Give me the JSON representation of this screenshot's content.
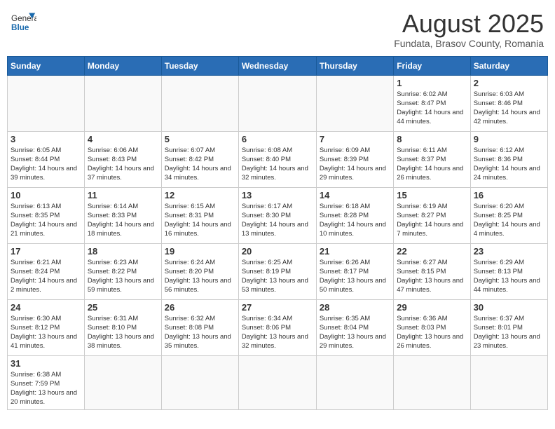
{
  "header": {
    "logo_general": "General",
    "logo_blue": "Blue",
    "month_title": "August 2025",
    "subtitle": "Fundata, Brasov County, Romania"
  },
  "weekdays": [
    "Sunday",
    "Monday",
    "Tuesday",
    "Wednesday",
    "Thursday",
    "Friday",
    "Saturday"
  ],
  "weeks": [
    [
      {
        "day": "",
        "info": ""
      },
      {
        "day": "",
        "info": ""
      },
      {
        "day": "",
        "info": ""
      },
      {
        "day": "",
        "info": ""
      },
      {
        "day": "",
        "info": ""
      },
      {
        "day": "1",
        "info": "Sunrise: 6:02 AM\nSunset: 8:47 PM\nDaylight: 14 hours and 44 minutes."
      },
      {
        "day": "2",
        "info": "Sunrise: 6:03 AM\nSunset: 8:46 PM\nDaylight: 14 hours and 42 minutes."
      }
    ],
    [
      {
        "day": "3",
        "info": "Sunrise: 6:05 AM\nSunset: 8:44 PM\nDaylight: 14 hours and 39 minutes."
      },
      {
        "day": "4",
        "info": "Sunrise: 6:06 AM\nSunset: 8:43 PM\nDaylight: 14 hours and 37 minutes."
      },
      {
        "day": "5",
        "info": "Sunrise: 6:07 AM\nSunset: 8:42 PM\nDaylight: 14 hours and 34 minutes."
      },
      {
        "day": "6",
        "info": "Sunrise: 6:08 AM\nSunset: 8:40 PM\nDaylight: 14 hours and 32 minutes."
      },
      {
        "day": "7",
        "info": "Sunrise: 6:09 AM\nSunset: 8:39 PM\nDaylight: 14 hours and 29 minutes."
      },
      {
        "day": "8",
        "info": "Sunrise: 6:11 AM\nSunset: 8:37 PM\nDaylight: 14 hours and 26 minutes."
      },
      {
        "day": "9",
        "info": "Sunrise: 6:12 AM\nSunset: 8:36 PM\nDaylight: 14 hours and 24 minutes."
      }
    ],
    [
      {
        "day": "10",
        "info": "Sunrise: 6:13 AM\nSunset: 8:35 PM\nDaylight: 14 hours and 21 minutes."
      },
      {
        "day": "11",
        "info": "Sunrise: 6:14 AM\nSunset: 8:33 PM\nDaylight: 14 hours and 18 minutes."
      },
      {
        "day": "12",
        "info": "Sunrise: 6:15 AM\nSunset: 8:31 PM\nDaylight: 14 hours and 16 minutes."
      },
      {
        "day": "13",
        "info": "Sunrise: 6:17 AM\nSunset: 8:30 PM\nDaylight: 14 hours and 13 minutes."
      },
      {
        "day": "14",
        "info": "Sunrise: 6:18 AM\nSunset: 8:28 PM\nDaylight: 14 hours and 10 minutes."
      },
      {
        "day": "15",
        "info": "Sunrise: 6:19 AM\nSunset: 8:27 PM\nDaylight: 14 hours and 7 minutes."
      },
      {
        "day": "16",
        "info": "Sunrise: 6:20 AM\nSunset: 8:25 PM\nDaylight: 14 hours and 4 minutes."
      }
    ],
    [
      {
        "day": "17",
        "info": "Sunrise: 6:21 AM\nSunset: 8:24 PM\nDaylight: 14 hours and 2 minutes."
      },
      {
        "day": "18",
        "info": "Sunrise: 6:23 AM\nSunset: 8:22 PM\nDaylight: 13 hours and 59 minutes."
      },
      {
        "day": "19",
        "info": "Sunrise: 6:24 AM\nSunset: 8:20 PM\nDaylight: 13 hours and 56 minutes."
      },
      {
        "day": "20",
        "info": "Sunrise: 6:25 AM\nSunset: 8:19 PM\nDaylight: 13 hours and 53 minutes."
      },
      {
        "day": "21",
        "info": "Sunrise: 6:26 AM\nSunset: 8:17 PM\nDaylight: 13 hours and 50 minutes."
      },
      {
        "day": "22",
        "info": "Sunrise: 6:27 AM\nSunset: 8:15 PM\nDaylight: 13 hours and 47 minutes."
      },
      {
        "day": "23",
        "info": "Sunrise: 6:29 AM\nSunset: 8:13 PM\nDaylight: 13 hours and 44 minutes."
      }
    ],
    [
      {
        "day": "24",
        "info": "Sunrise: 6:30 AM\nSunset: 8:12 PM\nDaylight: 13 hours and 41 minutes."
      },
      {
        "day": "25",
        "info": "Sunrise: 6:31 AM\nSunset: 8:10 PM\nDaylight: 13 hours and 38 minutes."
      },
      {
        "day": "26",
        "info": "Sunrise: 6:32 AM\nSunset: 8:08 PM\nDaylight: 13 hours and 35 minutes."
      },
      {
        "day": "27",
        "info": "Sunrise: 6:34 AM\nSunset: 8:06 PM\nDaylight: 13 hours and 32 minutes."
      },
      {
        "day": "28",
        "info": "Sunrise: 6:35 AM\nSunset: 8:04 PM\nDaylight: 13 hours and 29 minutes."
      },
      {
        "day": "29",
        "info": "Sunrise: 6:36 AM\nSunset: 8:03 PM\nDaylight: 13 hours and 26 minutes."
      },
      {
        "day": "30",
        "info": "Sunrise: 6:37 AM\nSunset: 8:01 PM\nDaylight: 13 hours and 23 minutes."
      }
    ],
    [
      {
        "day": "31",
        "info": "Sunrise: 6:38 AM\nSunset: 7:59 PM\nDaylight: 13 hours and 20 minutes."
      },
      {
        "day": "",
        "info": ""
      },
      {
        "day": "",
        "info": ""
      },
      {
        "day": "",
        "info": ""
      },
      {
        "day": "",
        "info": ""
      },
      {
        "day": "",
        "info": ""
      },
      {
        "day": "",
        "info": ""
      }
    ]
  ]
}
